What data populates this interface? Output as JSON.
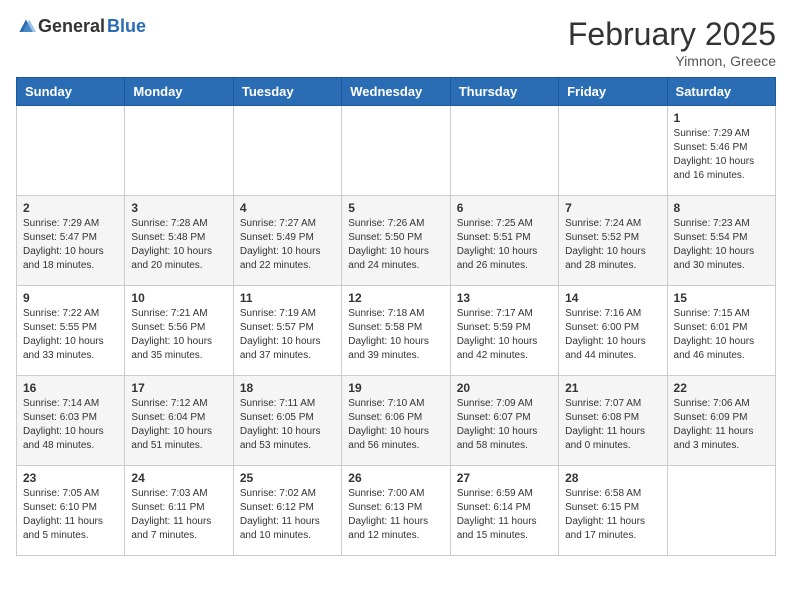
{
  "logo": {
    "general": "General",
    "blue": "Blue"
  },
  "header": {
    "month": "February 2025",
    "location": "Yimnon, Greece"
  },
  "days_of_week": [
    "Sunday",
    "Monday",
    "Tuesday",
    "Wednesday",
    "Thursday",
    "Friday",
    "Saturday"
  ],
  "weeks": [
    [
      {
        "num": "",
        "info": ""
      },
      {
        "num": "",
        "info": ""
      },
      {
        "num": "",
        "info": ""
      },
      {
        "num": "",
        "info": ""
      },
      {
        "num": "",
        "info": ""
      },
      {
        "num": "",
        "info": ""
      },
      {
        "num": "1",
        "info": "Sunrise: 7:29 AM\nSunset: 5:46 PM\nDaylight: 10 hours and 16 minutes."
      }
    ],
    [
      {
        "num": "2",
        "info": "Sunrise: 7:29 AM\nSunset: 5:47 PM\nDaylight: 10 hours and 18 minutes."
      },
      {
        "num": "3",
        "info": "Sunrise: 7:28 AM\nSunset: 5:48 PM\nDaylight: 10 hours and 20 minutes."
      },
      {
        "num": "4",
        "info": "Sunrise: 7:27 AM\nSunset: 5:49 PM\nDaylight: 10 hours and 22 minutes."
      },
      {
        "num": "5",
        "info": "Sunrise: 7:26 AM\nSunset: 5:50 PM\nDaylight: 10 hours and 24 minutes."
      },
      {
        "num": "6",
        "info": "Sunrise: 7:25 AM\nSunset: 5:51 PM\nDaylight: 10 hours and 26 minutes."
      },
      {
        "num": "7",
        "info": "Sunrise: 7:24 AM\nSunset: 5:52 PM\nDaylight: 10 hours and 28 minutes."
      },
      {
        "num": "8",
        "info": "Sunrise: 7:23 AM\nSunset: 5:54 PM\nDaylight: 10 hours and 30 minutes."
      }
    ],
    [
      {
        "num": "9",
        "info": "Sunrise: 7:22 AM\nSunset: 5:55 PM\nDaylight: 10 hours and 33 minutes."
      },
      {
        "num": "10",
        "info": "Sunrise: 7:21 AM\nSunset: 5:56 PM\nDaylight: 10 hours and 35 minutes."
      },
      {
        "num": "11",
        "info": "Sunrise: 7:19 AM\nSunset: 5:57 PM\nDaylight: 10 hours and 37 minutes."
      },
      {
        "num": "12",
        "info": "Sunrise: 7:18 AM\nSunset: 5:58 PM\nDaylight: 10 hours and 39 minutes."
      },
      {
        "num": "13",
        "info": "Sunrise: 7:17 AM\nSunset: 5:59 PM\nDaylight: 10 hours and 42 minutes."
      },
      {
        "num": "14",
        "info": "Sunrise: 7:16 AM\nSunset: 6:00 PM\nDaylight: 10 hours and 44 minutes."
      },
      {
        "num": "15",
        "info": "Sunrise: 7:15 AM\nSunset: 6:01 PM\nDaylight: 10 hours and 46 minutes."
      }
    ],
    [
      {
        "num": "16",
        "info": "Sunrise: 7:14 AM\nSunset: 6:03 PM\nDaylight: 10 hours and 48 minutes."
      },
      {
        "num": "17",
        "info": "Sunrise: 7:12 AM\nSunset: 6:04 PM\nDaylight: 10 hours and 51 minutes."
      },
      {
        "num": "18",
        "info": "Sunrise: 7:11 AM\nSunset: 6:05 PM\nDaylight: 10 hours and 53 minutes."
      },
      {
        "num": "19",
        "info": "Sunrise: 7:10 AM\nSunset: 6:06 PM\nDaylight: 10 hours and 56 minutes."
      },
      {
        "num": "20",
        "info": "Sunrise: 7:09 AM\nSunset: 6:07 PM\nDaylight: 10 hours and 58 minutes."
      },
      {
        "num": "21",
        "info": "Sunrise: 7:07 AM\nSunset: 6:08 PM\nDaylight: 11 hours and 0 minutes."
      },
      {
        "num": "22",
        "info": "Sunrise: 7:06 AM\nSunset: 6:09 PM\nDaylight: 11 hours and 3 minutes."
      }
    ],
    [
      {
        "num": "23",
        "info": "Sunrise: 7:05 AM\nSunset: 6:10 PM\nDaylight: 11 hours and 5 minutes."
      },
      {
        "num": "24",
        "info": "Sunrise: 7:03 AM\nSunset: 6:11 PM\nDaylight: 11 hours and 7 minutes."
      },
      {
        "num": "25",
        "info": "Sunrise: 7:02 AM\nSunset: 6:12 PM\nDaylight: 11 hours and 10 minutes."
      },
      {
        "num": "26",
        "info": "Sunrise: 7:00 AM\nSunset: 6:13 PM\nDaylight: 11 hours and 12 minutes."
      },
      {
        "num": "27",
        "info": "Sunrise: 6:59 AM\nSunset: 6:14 PM\nDaylight: 11 hours and 15 minutes."
      },
      {
        "num": "28",
        "info": "Sunrise: 6:58 AM\nSunset: 6:15 PM\nDaylight: 11 hours and 17 minutes."
      },
      {
        "num": "",
        "info": ""
      }
    ]
  ]
}
